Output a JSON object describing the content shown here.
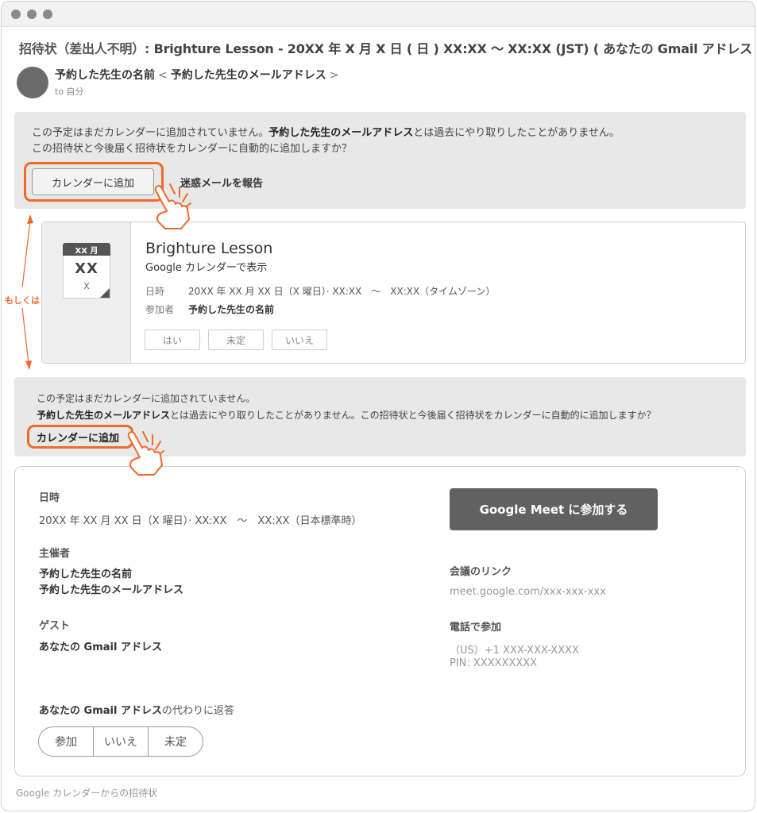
{
  "email": {
    "subject_prefix": "招待状（差出人不明）:",
    "subject_body": " Brighture Lesson - 20XX 年 X 月 X 日 ( 日 ) XX:XX 〜 XX:XX (JST) ( あなたの Gmail アドレス )",
    "sender_name": "予約した先生の名前",
    "sender_open": "<",
    "sender_email": "予約した先生のメールアドレス",
    "sender_close": ">",
    "recipient": "to 自分"
  },
  "notice_top": {
    "line1_a": "この予定はまだカレンダーに追加されていません。",
    "line1_b": "予約した先生のメールアドレス",
    "line1_c": "とは過去にやり取りしたことがありません。",
    "line2": "この招待状と今後届く招待状をカレンダーに自動的に追加しますか？",
    "add_button": "カレンダーに追加",
    "spam_link": "迷惑メールを報告"
  },
  "annotation": {
    "or_label": "もしくは",
    "accent_color": "#f06a2a"
  },
  "event_card": {
    "icon_month": "XX 月",
    "icon_day": "XX",
    "icon_weekday": "X",
    "title": "Brighture Lesson",
    "subtitle": "Google カレンダーで表示",
    "time_label": "日時",
    "time_value": "20XX 年 XX 月 XX 日（X 曜日）· XX:XX　〜　XX:XX（タイムゾーン）",
    "attendee_label": "参加者",
    "attendee_value": "予約した先生の名前",
    "rsvp": [
      "はい",
      "未定",
      "いいえ"
    ]
  },
  "notice_bottom": {
    "line1": "この予定はまだカレンダーに追加されていません。",
    "line2_a": "予約した先生のメールアドレス",
    "line2_b": "とは過去にやり取りしたことがありません。この招待状と今後届く招待状をカレンダーに自動的に追加しますか？",
    "add_link": "カレンダーに追加"
  },
  "details": {
    "when_label": "日時",
    "when_value": "20XX 年 XX 月 XX 日（X 曜日）· XX:XX　〜　XX:XX（日本標準時）",
    "organizer_label": "主催者",
    "organizer_name": "予約した先生の名前",
    "organizer_email": "予約した先生のメールアドレス",
    "guests_label": "ゲスト",
    "guest_value": "あなたの Gmail アドレス",
    "meet_button": "Google Meet に参加する",
    "link_label": "会議のリンク",
    "link_value": "meet.google.com/xxx-xxx-xxx",
    "phone_label": "電話で参加",
    "phone_number": "（US）+1 XXX-XXX-XXXX",
    "phone_pin": "PIN: XXXXXXXXX",
    "reply_as_bold": "あなたの Gmail アドレス",
    "reply_as_suffix": "の代わりに返答",
    "reply_options": [
      "参加",
      "いいえ",
      "未定"
    ]
  },
  "footer": "Google カレンダーからの招待状"
}
